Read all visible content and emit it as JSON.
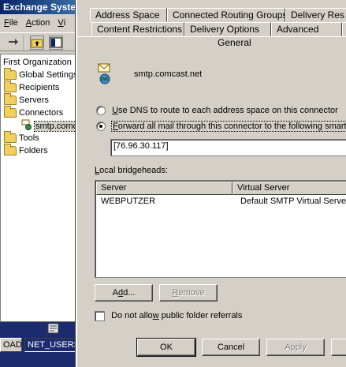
{
  "background_window": {
    "title": "Exchange System",
    "menu": [
      {
        "label": "File",
        "accel": "F",
        "rest": "ile"
      },
      {
        "label": "Action",
        "accel": "A",
        "rest": "ction"
      },
      {
        "label": "Vi",
        "accel": "V",
        "rest": "i"
      }
    ],
    "toolbar": [
      {
        "name": "forward-arrow-icon",
        "glyph": "➡"
      },
      {
        "name": "up-folder-icon",
        "glyph": "📁"
      },
      {
        "name": "show-hide-tree-icon",
        "glyph": "▦"
      }
    ],
    "tree": {
      "root": "First Organization",
      "items": [
        "Global Settings",
        "Recipients",
        "Servers",
        "Connectors",
        "smtp.comcast.net",
        "Tools",
        "Folders"
      ]
    },
    "taskbar": [
      "OADS",
      "NET_USERS."
    ]
  },
  "dialog": {
    "tabs_row1": [
      "Address Space",
      "Connected Routing Groups",
      "Delivery Res"
    ],
    "tabs_row2": [
      "Content Restrictions",
      "Delivery Options",
      "Advanced"
    ],
    "active_tab": "General",
    "connector_name": "smtp.comcast.net",
    "radio_dns": {
      "accel": "U",
      "rest": "se DNS to route to each address space on this connector",
      "checked": false
    },
    "radio_smarthost": {
      "accel": "F",
      "rest": "orward all mail through this connector to the following smart hos",
      "checked": true
    },
    "smarthost_value": "[76.96.30.117]",
    "bridgeheads_label": {
      "prefix": "",
      "accel": "L",
      "rest": "ocal bridgeheads:"
    },
    "bridgeheads": {
      "columns": [
        "Server",
        "Virtual Server"
      ],
      "rows": [
        {
          "server": "WEBPUTZER",
          "virtual_server": "Default SMTP Virtual Server"
        }
      ]
    },
    "add_button": {
      "accel": "d",
      "before": "A",
      "after": "d..."
    },
    "remove_button": {
      "accel": "R",
      "rest": "emove"
    },
    "no_public_folder_referrals": {
      "prefix": "Do not allo",
      "accel": "w",
      "rest": " public folder referrals",
      "checked": false
    },
    "footer_buttons": {
      "ok": "OK",
      "cancel": "Cancel",
      "apply": "Apply"
    }
  }
}
